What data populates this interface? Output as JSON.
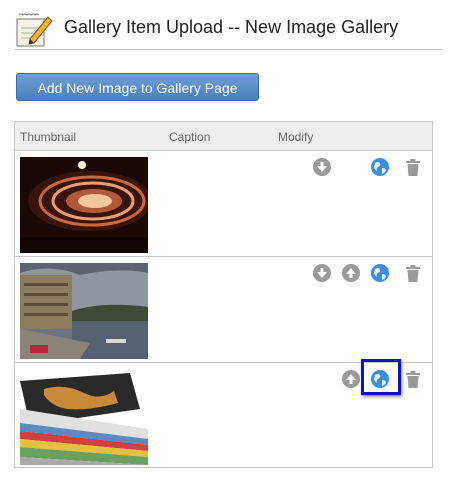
{
  "header": {
    "title": "Gallery Item Upload -- New Image Gallery",
    "icon": "notepad-pencil-icon"
  },
  "toolbar": {
    "add_label": "Add New Image to Gallery Page"
  },
  "table": {
    "columns": [
      "Thumbnail",
      "Caption",
      "Modify"
    ],
    "rows": [
      {
        "thumbnail": "concert-lights-image",
        "caption": "",
        "actions": [
          "move-down-icon",
          "globe-icon",
          "trash-icon"
        ]
      },
      {
        "thumbnail": "river-town-image",
        "caption": "",
        "actions": [
          "move-down-icon",
          "move-up-icon",
          "globe-icon",
          "trash-icon"
        ]
      },
      {
        "thumbnail": "magazines-stack-image",
        "caption": "",
        "actions": [
          "move-up-icon",
          "globe-icon",
          "trash-icon"
        ]
      }
    ]
  },
  "colors": {
    "button": "#4a7fbf",
    "highlight": "#1111cc",
    "action_icon": "#9a9a9a",
    "globe": "#3a8fd8"
  }
}
